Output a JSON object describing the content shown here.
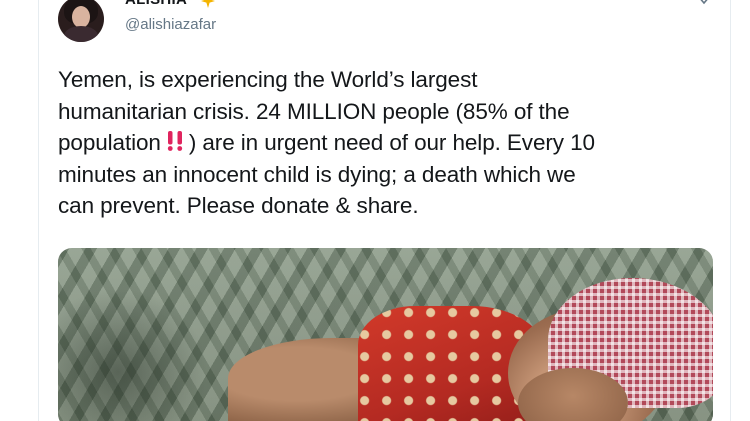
{
  "user": {
    "display_name": "ALISHIA",
    "handle": "@alishiazafar",
    "name_badge_icon": "sparkle-star-icon",
    "menu_icon": "chevron-down-icon"
  },
  "tweet": {
    "lines": [
      "Yemen, is experiencing the World’s largest",
      "humanitarian crisis. 24 MILLION people (85% of the",
      "population",
      ") are in urgent need of our help. Every 10",
      "minutes an innocent child is dying; a death which we",
      "can prevent. Please donate & share."
    ],
    "emoji_icon": "double-exclamation-icon"
  },
  "media": {
    "icon": "photo-icon"
  },
  "colors": {
    "text": "#14171a",
    "secondary_text": "#657786",
    "border": "#e6ecf0",
    "emoji_red": "#e0245e",
    "star": "#f4b400"
  }
}
